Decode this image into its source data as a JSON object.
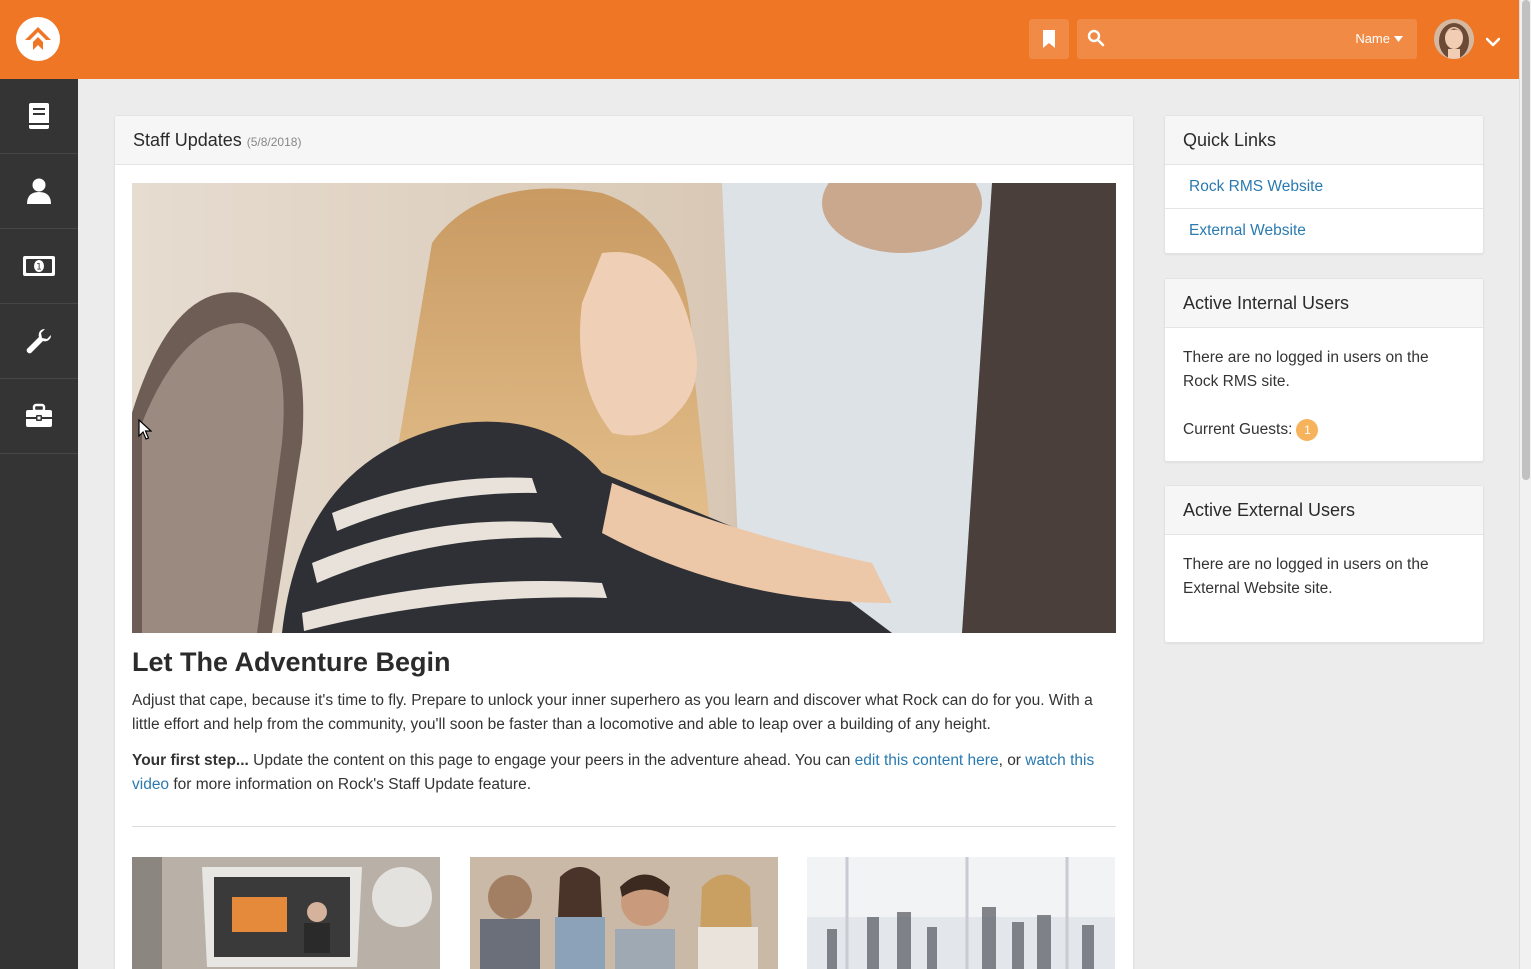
{
  "header": {
    "search_placeholder": "",
    "search_type": "Name"
  },
  "sidebar": {
    "items": [
      {
        "icon": "book-icon"
      },
      {
        "icon": "person-icon"
      },
      {
        "icon": "money-icon"
      },
      {
        "icon": "wrench-icon"
      },
      {
        "icon": "briefcase-icon"
      }
    ]
  },
  "staff_updates": {
    "title": "Staff Updates",
    "date": "(5/8/2018)",
    "article_title": "Let The Adventure Begin",
    "paragraph1": "Adjust that cape, because it's time to fly. Prepare to unlock your inner superhero as you learn and discover what Rock can do for you. With a little effort and help from the community, you'll soon be faster than a locomotive and able to leap over a building of any height.",
    "p2_bold": "Your first step...",
    "p2_text1": " Update the content on this page to engage your peers in the adventure ahead. You can ",
    "p2_link1": "edit this content here",
    "p2_text2": ", or ",
    "p2_link2": "watch this video",
    "p2_text3": " for more information on Rock's Staff Update feature."
  },
  "quick_links": {
    "title": "Quick Links",
    "items": [
      "Rock RMS Website",
      "External Website"
    ]
  },
  "active_internal": {
    "title": "Active Internal Users",
    "message": "There are no logged in users on the Rock RMS site.",
    "guests_label": "Current Guests:",
    "guests_count": "1"
  },
  "active_external": {
    "title": "Active External Users",
    "message": "There are no logged in users on the External Website site."
  },
  "colors": {
    "brand": "#ee7625",
    "sidebar": "#343434",
    "link": "#2a7ab0"
  }
}
